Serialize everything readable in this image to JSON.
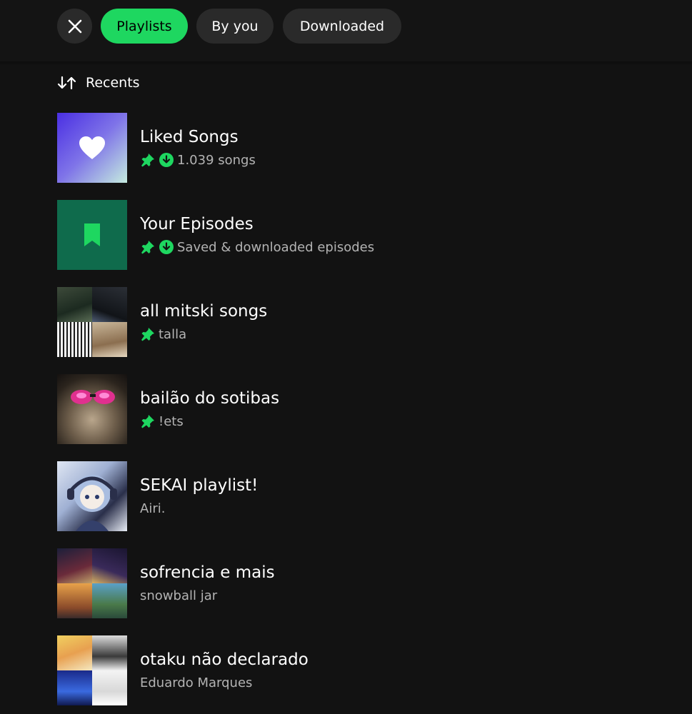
{
  "filters": {
    "chips": [
      {
        "label": "Playlists",
        "active": true
      },
      {
        "label": "By you",
        "active": false
      },
      {
        "label": "Downloaded",
        "active": false
      }
    ]
  },
  "sort": {
    "label": "Recents"
  },
  "library": {
    "items": [
      {
        "title": "Liked Songs",
        "subtitle": "1.039 songs",
        "pinned": true,
        "downloaded": true
      },
      {
        "title": "Your Episodes",
        "subtitle": "Saved & downloaded episodes",
        "pinned": true,
        "downloaded": true
      },
      {
        "title": "all mitski songs",
        "subtitle": "talla",
        "pinned": true,
        "downloaded": false
      },
      {
        "title": "bailão do sotibas",
        "subtitle": "!ets",
        "pinned": true,
        "downloaded": false
      },
      {
        "title": "SEKAI playlist!",
        "subtitle": "Airi.",
        "pinned": false,
        "downloaded": false
      },
      {
        "title": "sofrencia e mais",
        "subtitle": "snowball jar",
        "pinned": false,
        "downloaded": false
      },
      {
        "title": "otaku não declarado",
        "subtitle": "Eduardo Marques",
        "pinned": false,
        "downloaded": false
      }
    ]
  },
  "colors": {
    "accent": "#1ed760",
    "background": "#121212",
    "chip": "#2a2a2a",
    "subtext": "#b3b3b3"
  }
}
